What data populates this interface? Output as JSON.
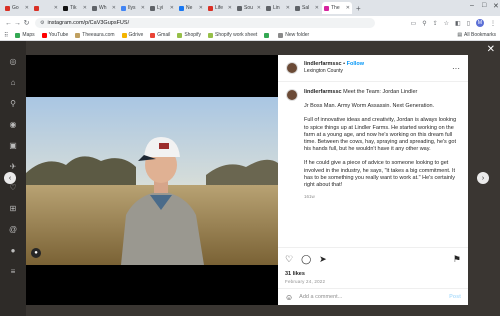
{
  "browser": {
    "tabs": [
      {
        "label": "Go",
        "color": "#d93025"
      },
      {
        "label": "",
        "color": "#d93025"
      },
      {
        "label": "Tik",
        "color": "#111111"
      },
      {
        "label": "Wh",
        "color": "#5f6368"
      },
      {
        "label": "Ilys",
        "color": "#4285f4"
      },
      {
        "label": "Lyi",
        "color": "#5f6368"
      },
      {
        "label": "Ne",
        "color": "#1877f2"
      },
      {
        "label": "Life",
        "color": "#d93025"
      },
      {
        "label": "Sou",
        "color": "#5f6368"
      },
      {
        "label": "Lin",
        "color": "#5f6368"
      },
      {
        "label": "Sal",
        "color": "#5f6368"
      },
      {
        "label": "The",
        "color": "#d6249f"
      }
    ],
    "url": "instagram.com/p/CaV3GupsFUS/",
    "profile_initial": "M",
    "bookmarks": [
      {
        "label": "Maps",
        "color": "#34a853"
      },
      {
        "label": "YouTube",
        "color": "#ff0000"
      },
      {
        "label": "Theeaura.com",
        "color": "#c0a060"
      },
      {
        "label": "Gdrive",
        "color": "#f4b400"
      },
      {
        "label": "Gmail",
        "color": "#ea4335"
      },
      {
        "label": "Shopify",
        "color": "#96bf48"
      },
      {
        "label": "Shopify work sheet",
        "color": "#96bf48"
      },
      {
        "label": "",
        "color": "#34a853"
      },
      {
        "label": "New folder",
        "color": "#8a8a8a"
      }
    ],
    "all_bookmarks": "All Bookmarks"
  },
  "post": {
    "username": "lindlerfarmssc",
    "follow": "Follow",
    "location": "Lexington County",
    "caption_user": "lindlerfarmssc",
    "caption_title": "Meet the Team: Jordan Lindler",
    "paragraphs": [
      "Jr Boss Man. Army Worm Assassin. Next Generation.",
      "Full of innovative ideas and creativity, Jordan is always looking to spice things up at Lindler Farms. He started working on the farm at a young age, and now he's working on this dream full time. Between the cows, hay, spraying and spreading, he's got his hands full, but he wouldn't have it any other way.",
      "If he could give a piece of advice to someone looking to get involved in the industry, he says, \"it takes a big commitment. It has to be something you really want to work at.\" He's certainly right about that!"
    ],
    "caption_time": "161w",
    "likes": "31 likes",
    "date": "February 24, 2022",
    "comment_placeholder": "Add a comment...",
    "post_label": "Post"
  }
}
